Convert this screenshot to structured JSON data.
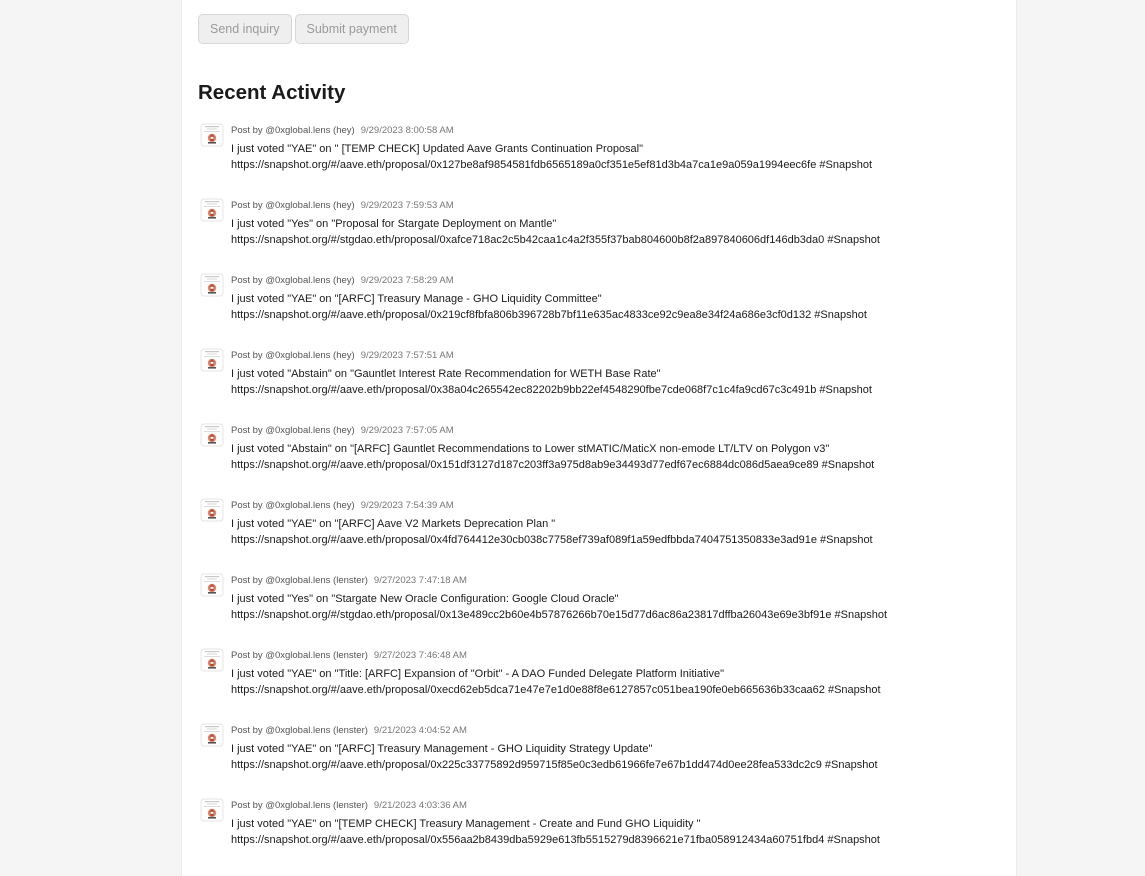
{
  "actions": {
    "send_inquiry_label": "Send inquiry",
    "submit_payment_label": "Submit payment"
  },
  "section_title": "Recent Activity",
  "activity": [
    {
      "author": "Post by @0xglobal.lens (hey)",
      "timestamp": "9/29/2023 8:00:58 AM",
      "text": "I just voted \"YAE\" on \" [TEMP CHECK] Updated Aave Grants Continuation Proposal\"",
      "link": "https://snapshot.org/#/aave.eth/proposal/0x127be8af9854581fdb6565189a0cf351e5ef81d3b4a7ca1e9a059a1994eec6fe #Snapshot"
    },
    {
      "author": "Post by @0xglobal.lens (hey)",
      "timestamp": "9/29/2023 7:59:53 AM",
      "text": "I just voted \"Yes\" on \"Proposal for Stargate Deployment on Mantle\"",
      "link": "https://snapshot.org/#/stgdao.eth/proposal/0xafce718ac2c5b42caa1c4a2f355f37bab804600b8f2a897840606df146db3da0 #Snapshot"
    },
    {
      "author": "Post by @0xglobal.lens (hey)",
      "timestamp": "9/29/2023 7:58:29 AM",
      "text": "I just voted \"YAE\" on \"[ARFC] Treasury Manage - GHO Liquidity Committee\"",
      "link": "https://snapshot.org/#/aave.eth/proposal/0x219cf8fbfa806b396728b7bf11e635ac4833ce92c9ea8e34f24a686e3cf0d132 #Snapshot"
    },
    {
      "author": "Post by @0xglobal.lens (hey)",
      "timestamp": "9/29/2023 7:57:51 AM",
      "text": "I just voted \"Abstain\" on \"Gauntlet Interest Rate Recommendation for WETH Base Rate\"",
      "link": "https://snapshot.org/#/aave.eth/proposal/0x38a04c265542ec82202b9bb22ef4548290fbe7cde068f7c1c4fa9cd67c3c491b #Snapshot"
    },
    {
      "author": "Post by @0xglobal.lens (hey)",
      "timestamp": "9/29/2023 7:57:05 AM",
      "text": "I just voted \"Abstain\" on \"[ARFC] Gauntlet Recommendations to Lower stMATIC/MaticX non-emode LT/LTV on Polygon v3\"",
      "link": "https://snapshot.org/#/aave.eth/proposal/0x151df3127d187c203ff3a975d8ab9e34493d77edf67ec6884dc086d5aea9ce89 #Snapshot"
    },
    {
      "author": "Post by @0xglobal.lens (hey)",
      "timestamp": "9/29/2023 7:54:39 AM",
      "text": "I just voted \"YAE\" on \"[ARFC] Aave V2 Markets Deprecation Plan \"",
      "link": "https://snapshot.org/#/aave.eth/proposal/0x4fd764412e30cb038c7758ef739af089f1a59edfbbda7404751350833e3ad91e #Snapshot"
    },
    {
      "author": "Post by @0xglobal.lens (lenster)",
      "timestamp": "9/27/2023 7:47:18 AM",
      "text": "I just voted \"Yes\" on \"Stargate New Oracle Configuration: Google Cloud Oracle\"",
      "link": "https://snapshot.org/#/stgdao.eth/proposal/0x13e489cc2b60e4b57876266b70e15d77d6ac86a23817dffba26043e69e3bf91e #Snapshot"
    },
    {
      "author": "Post by @0xglobal.lens (lenster)",
      "timestamp": "9/27/2023 7:46:48 AM",
      "text": "I just voted \"YAE\" on \"Title: [ARFC] Expansion of \"Orbit\" - A DAO Funded Delegate Platform Initiative\"",
      "link": "https://snapshot.org/#/aave.eth/proposal/0xecd62eb5dca71e47e7e1d0e88f8e6127857c051bea190fe0eb665636b33caa62 #Snapshot"
    },
    {
      "author": "Post by @0xglobal.lens (lenster)",
      "timestamp": "9/21/2023 4:04:52 AM",
      "text": "I just voted \"YAE\" on \"[ARFC] Treasury Management - GHO Liquidity Strategy Update\"",
      "link": "https://snapshot.org/#/aave.eth/proposal/0x225c33775892d959715f85e0c3edb61966fe7e67b1dd474d0ee28fea533dc2c9 #Snapshot"
    },
    {
      "author": "Post by @0xglobal.lens (lenster)",
      "timestamp": "9/21/2023 4:03:36 AM",
      "text": "I just voted \"YAE\" on \"[TEMP CHECK] Treasury Management - Create and Fund GHO Liquidity \"",
      "link": "https://snapshot.org/#/aave.eth/proposal/0x556aa2b8439dba5929e613fb5515279d8396621e71fba058912434a60751fbd4 #Snapshot"
    }
  ]
}
